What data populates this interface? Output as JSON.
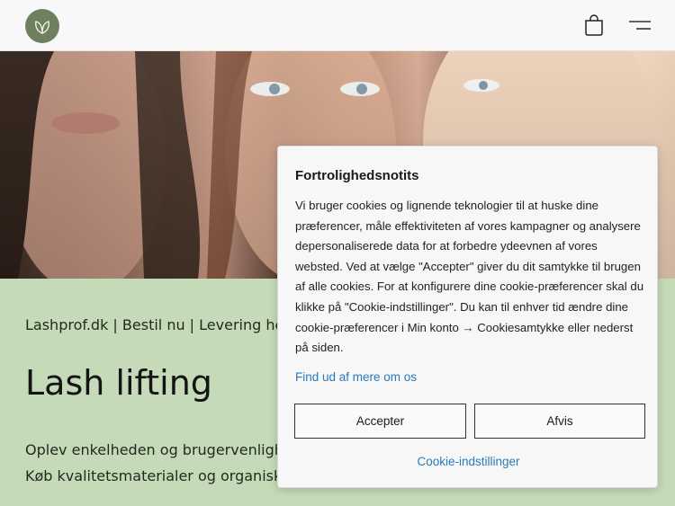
{
  "header": {
    "logo_icon": "leaf-logo-icon",
    "cart_icon": "shopping-bag-icon",
    "menu_icon": "hamburger-menu-icon"
  },
  "hero": {
    "image": "three-women-faces-photo"
  },
  "main": {
    "tagline": "Lashprof.dk | Bestil nu | Levering he",
    "title": "Lash lifting",
    "description_line1": "Oplev enkelheden og brugervenligh",
    "description_line2": "Køb kvalitetsmaterialer og organisk"
  },
  "cookie_dialog": {
    "title": "Fortrolighedsnotits",
    "body": "Vi bruger cookies og lignende teknologier til at huske dine præferencer, måle effektiviteten af vores kampagner og analysere depersonaliserede data for at forbedre ydeevnen af vores websted. Ved at vælge \"Accepter\" giver du dit samtykke til brugen af alle cookies. For at konfigurere dine cookie-præferencer skal du klikke på \"Cookie-indstillinger\". Du kan til enhver tid ændre dine cookie-præferencer i Min konto → Cookiesamtykke eller nederst på siden.",
    "learn_more": "Find ud af mere om os",
    "accept_label": "Accepter",
    "reject_label": "Afvis",
    "settings_label": "Cookie-indstillinger"
  },
  "colors": {
    "header_bg": "#f8f8f8",
    "page_bg": "#c4dab8",
    "link": "#2a7ab8",
    "logo_bg": "#6f8060"
  }
}
